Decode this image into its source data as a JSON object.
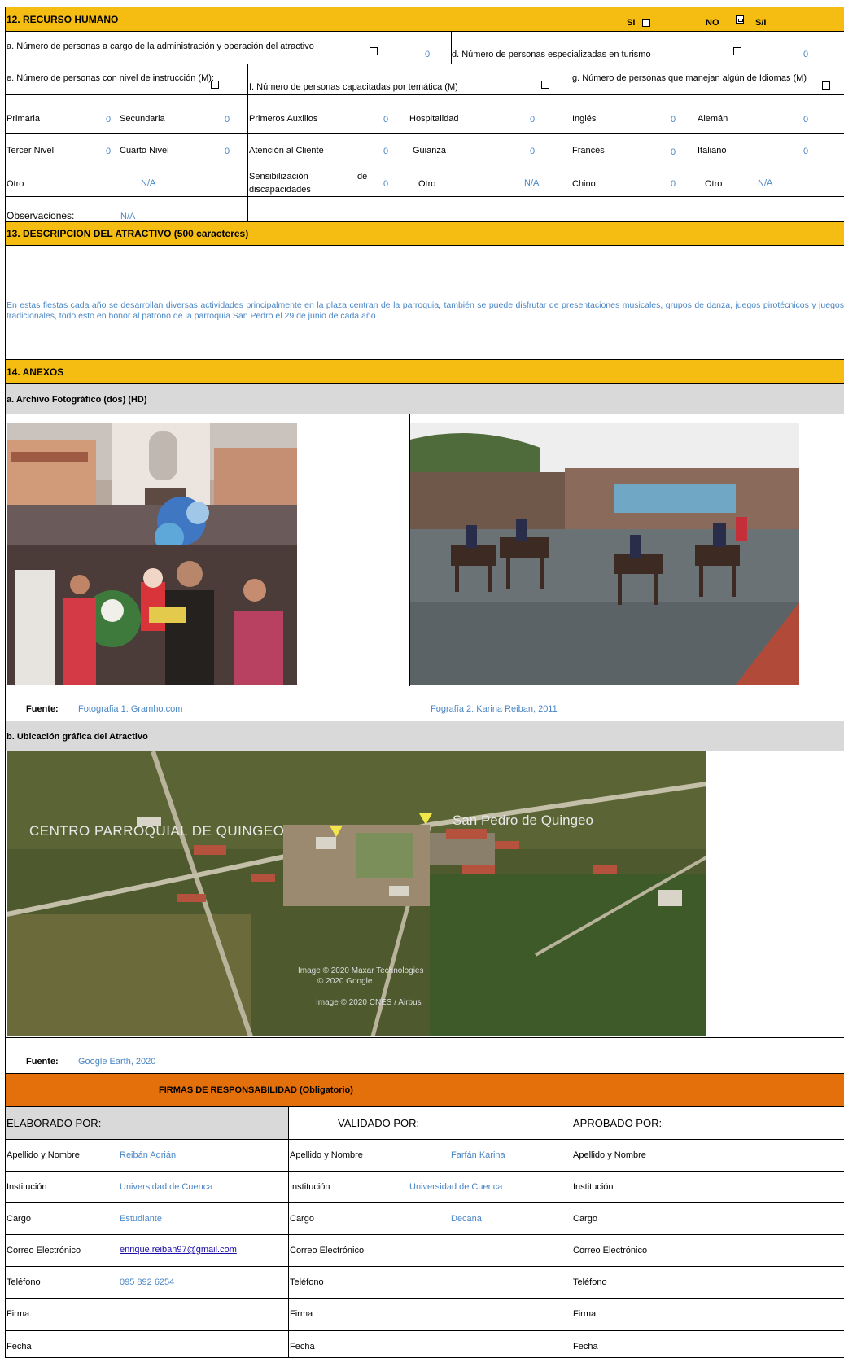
{
  "recurso": {
    "title": "12. RECURSO HUMANO",
    "si": "SI",
    "no": "NO",
    "sn": "S/I",
    "a_label": "a. Número de personas a cargo de la administración y  operación  del atractivo",
    "a_value": "0",
    "d_label": "d. Número de personas especializadas en turismo",
    "d_value": "0",
    "e_label": "e. Número de personas con nivel de instrucción (M):",
    "f_label": "f. Número de personas capacitadas por temática (M)",
    "g_label": "g. Número de personas que manejan algún de Idiomas (M)",
    "primaria": "Primaria",
    "primaria_v": "0",
    "secundaria": "Secundaria",
    "secundaria_v": "0",
    "primeros": "Primeros Auxilios",
    "primeros_v": "0",
    "hospitalidad": "Hospitalidad",
    "hospitalidad_v": "0",
    "ingles": "Inglés",
    "ingles_v": "0",
    "aleman": "Alemán",
    "aleman_v": "0",
    "tercer": "Tercer Nivel",
    "tercer_v": "0",
    "cuarto": "Cuarto Nivel",
    "cuarto_v": "0",
    "atencion": "Atención al Cliente",
    "atencion_v": "0",
    "guianza": "Guianza",
    "guianza_v": "0",
    "frances": "Francés",
    "frances_v": "0",
    "italiano": "Italiano",
    "italiano_v": "0",
    "otro1": "Otro",
    "otro1_v": "N/A",
    "sensib1": "Sensibilización",
    "sensib_de": "de",
    "sensib2": "discapacidades",
    "sensib_v": "0",
    "otro2": "Otro",
    "otro2_v": "N/A",
    "chino": "Chino",
    "chino_v": "0",
    "otro3": "Otro",
    "otro3_v": "N/A",
    "obs_label": "Observaciones:",
    "obs_value": "N/A"
  },
  "descripcion": {
    "title": "13. DESCRIPCION DEL ATRACTIVO (500 caracteres)",
    "text": "En estas fiestas cada año se desarrollan diversas actividades principalmente en la plaza centran de  la parroquia,  también  se  puede disfrutar  de presentaciones  musicales,  grupos de danza, juegos pirotécnicos y juegos tradicionales, todo esto en honor al patrono de la parroquia San Pedro el 29 de junio de cada año."
  },
  "anexos": {
    "title": "14. ANEXOS",
    "foto_title": "a. Archivo Fotográfico (dos) (HD)",
    "fuente_label": "Fuente:",
    "fuente1": "Fotografia 1:  Gramho.com",
    "fuente2": "Fografía 2: Karina Reiban, 2011",
    "ubic_title": "b. Ubicación gráfica del Atractivo",
    "map_label1": "CENTRO PARROQUIAL DE QUINGEO",
    "map_label2": "San Pedro de Quingeo",
    "map_credit1": "Image © 2020 Maxar Technologies",
    "map_credit2": "© 2020 Google",
    "map_credit3": "Image © 2020 CNES / Airbus",
    "fuente3": "Google Earth, 2020"
  },
  "firmas": {
    "title": "FIRMAS DE RESPONSABILIDAD (Obligatorio)",
    "elaborado": "ELABORADO POR:",
    "validado": "VALIDADO POR:",
    "aprobado": "APROBADO POR:",
    "apellido": "Apellido y Nombre",
    "institucion": "Institución",
    "cargo": "Cargo",
    "correo": "Correo Electrónico",
    "telefono": "Teléfono",
    "firma": "Firma",
    "fecha": "Fecha",
    "e_nombre": "Reibán Adrián",
    "e_inst": "Universidad de Cuenca",
    "e_cargo": "Estudiante",
    "e_correo": "enrique.reiban97@gmail.com",
    "e_tel": "095 892 6254",
    "v_nombre": "Farfán Karina",
    "v_inst": "Universidad de Cuenca",
    "v_cargo": "Decana"
  }
}
